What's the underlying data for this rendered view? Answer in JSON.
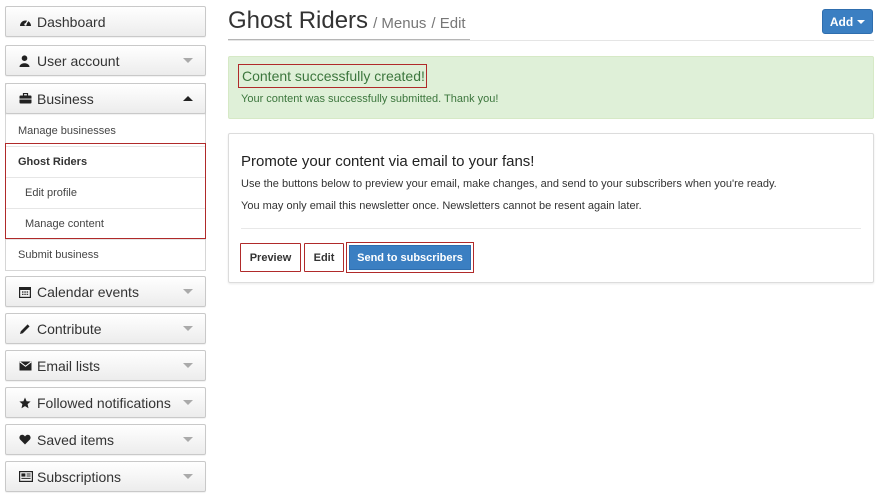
{
  "sidebar": {
    "dashboard": "Dashboard",
    "user_account": "User account",
    "business": "Business",
    "business_items": [
      "Manage businesses",
      "Ghost Riders",
      "Edit profile",
      "Manage content",
      "Submit business"
    ],
    "calendar_events": "Calendar events",
    "contribute": "Contribute",
    "email_lists": "Email lists",
    "followed_notifications": "Followed notifications",
    "saved_items": "Saved items",
    "subscriptions": "Subscriptions"
  },
  "header": {
    "title": "Ghost Riders",
    "crumb1": "/ Menus",
    "crumb2": "/ Edit",
    "add_label": "Add"
  },
  "alert": {
    "title": "Content successfully created!",
    "text": "Your content was successfully submitted. Thank you!"
  },
  "card": {
    "title": "Promote your content via email to your fans!",
    "p1": "Use the buttons below to preview your email, make changes, and send to your subscribers when you're ready.",
    "p2": "You may only email this newsletter once. Newsletters cannot be resent again later.",
    "preview_label": "Preview",
    "edit_label": "Edit",
    "send_label": "Send to subscribers"
  },
  "colors": {
    "primary": "#3b7fc2",
    "success_bg": "#dff0d8",
    "success_text": "#3c763d",
    "highlight": "#b02a2a"
  }
}
